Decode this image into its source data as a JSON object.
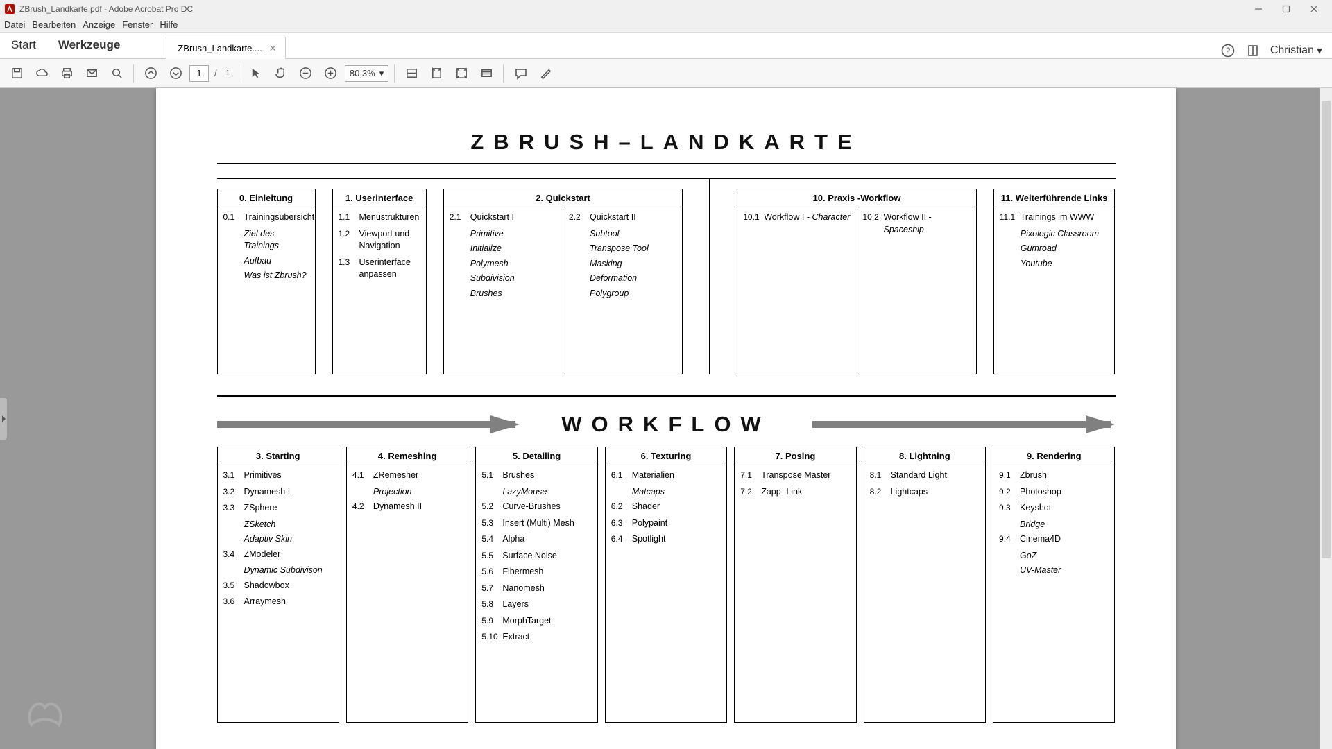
{
  "app": {
    "title": "ZBrush_Landkarte.pdf - Adobe Acrobat Pro DC",
    "menus": [
      "Datei",
      "Bearbeiten",
      "Anzeige",
      "Fenster",
      "Hilfe"
    ],
    "tabs": {
      "start": "Start",
      "tools": "Werkzeuge",
      "doc": "ZBrush_Landkarte...."
    },
    "user": "Christian",
    "page_current": "1",
    "page_total": "1",
    "zoom": "80,3%"
  },
  "doc": {
    "title": "ZBRUSH–LANDKARTE",
    "workflow_title": "WORKFLOW",
    "row1": {
      "b0": {
        "hdr": "0. Einleitung",
        "items": [
          {
            "n": "0.1",
            "t": "Trainingsübersicht"
          }
        ],
        "subs0": [
          "Ziel des Trainings",
          "Aufbau",
          "Was ist Zbrush?"
        ]
      },
      "b1": {
        "hdr": "1. Userinterface",
        "items": [
          {
            "n": "1.1",
            "t": "Menüstrukturen"
          },
          {
            "n": "1.2",
            "t": "Viewport und Navigation"
          },
          {
            "n": "1.3",
            "t": "Userinterface anpassen"
          }
        ]
      },
      "b2": {
        "hdr": "2. Quickstart",
        "left": {
          "n": "2.1",
          "t": "Quickstart I",
          "subs": [
            "Primitive",
            "Initialize",
            "Polymesh",
            "Subdivision",
            "Brushes"
          ]
        },
        "right": {
          "n": "2.2",
          "t": "Quickstart II",
          "subs": [
            "Subtool",
            "Transpose Tool",
            "Masking",
            "Deformation",
            "Polygroup"
          ]
        }
      },
      "b10": {
        "hdr": "10. Praxis -Workflow",
        "left": {
          "n": "10.1",
          "t": "Workflow I - ",
          "ap": "Character"
        },
        "right": {
          "n": "10.2",
          "t": "Workflow II - ",
          "ap": "Spaceship"
        }
      },
      "b11": {
        "hdr": "11. Weiterführende Links",
        "items": [
          {
            "n": "11.1",
            "t": "Trainings im WWW"
          }
        ],
        "subs0": [
          "Pixologic Classroom",
          "Gumroad",
          "Youtube"
        ]
      }
    },
    "row3": {
      "b3": {
        "hdr": "3. Starting",
        "items": [
          {
            "n": "3.1",
            "t": "Primitives"
          },
          {
            "n": "3.2",
            "t": "Dynamesh I"
          },
          {
            "n": "3.3",
            "t": "ZSphere",
            "subs": [
              "ZSketch",
              "Adaptiv Skin"
            ]
          },
          {
            "n": "3.4",
            "t": "ZModeler",
            "subs": [
              "Dynamic Subdivison"
            ]
          },
          {
            "n": "3.5",
            "t": "Shadowbox"
          },
          {
            "n": "3.6",
            "t": "Arraymesh"
          }
        ]
      },
      "b4": {
        "hdr": "4. Remeshing",
        "items": [
          {
            "n": "4.1",
            "t": "ZRemesher",
            "subs": [
              "Projection"
            ]
          },
          {
            "n": "4.2",
            "t": "Dynamesh II"
          }
        ]
      },
      "b5": {
        "hdr": "5. Detailing",
        "items": [
          {
            "n": "5.1",
            "t": "Brushes",
            "subs": [
              "LazyMouse"
            ]
          },
          {
            "n": "5.2",
            "t": "Curve-Brushes"
          },
          {
            "n": "5.3",
            "t": "Insert (Multi) Mesh"
          },
          {
            "n": "5.4",
            "t": "Alpha"
          },
          {
            "n": "5.5",
            "t": "Surface Noise"
          },
          {
            "n": "5.6",
            "t": "Fibermesh"
          },
          {
            "n": "5.7",
            "t": "Nanomesh"
          },
          {
            "n": "5.8",
            "t": "Layers"
          },
          {
            "n": "5.9",
            "t": "MorphTarget"
          },
          {
            "n": "5.10",
            "t": "Extract"
          }
        ]
      },
      "b6": {
        "hdr": "6. Texturing",
        "items": [
          {
            "n": "6.1",
            "t": "Materialien",
            "subs": [
              "Matcaps"
            ]
          },
          {
            "n": "6.2",
            "t": "Shader"
          },
          {
            "n": "6.3",
            "t": "Polypaint"
          },
          {
            "n": "6.4",
            "t": "Spotlight"
          }
        ]
      },
      "b7": {
        "hdr": "7. Posing",
        "items": [
          {
            "n": "7.1",
            "t": "Transpose Master"
          },
          {
            "n": "7.2",
            "t": "Zapp -Link"
          }
        ]
      },
      "b8": {
        "hdr": "8. Lightning",
        "items": [
          {
            "n": "8.1",
            "t": "Standard Light"
          },
          {
            "n": "8.2",
            "t": "Lightcaps"
          }
        ]
      },
      "b9": {
        "hdr": "9. Rendering",
        "items": [
          {
            "n": "9.1",
            "t": "Zbrush"
          },
          {
            "n": "9.2",
            "t": "Photoshop"
          },
          {
            "n": "9.3",
            "t": "Keyshot",
            "subs": [
              "Bridge"
            ]
          },
          {
            "n": "9.4",
            "t": "Cinema4D",
            "subs": [
              "GoZ",
              "UV-Master"
            ]
          }
        ]
      }
    }
  }
}
